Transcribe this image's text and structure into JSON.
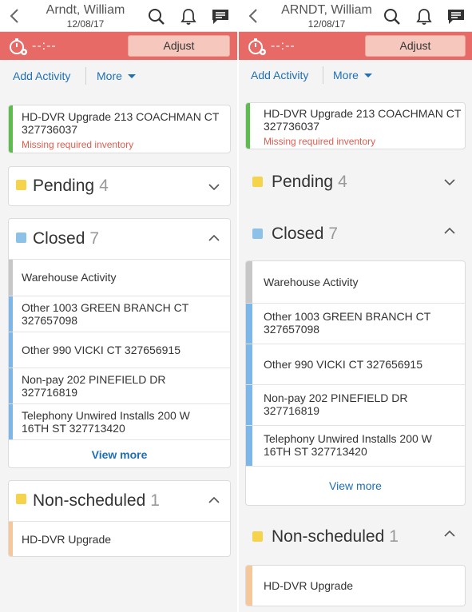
{
  "colors": {
    "red_bar": "#e86a66",
    "link_blue": "#1f6fb5",
    "pending_yellow": "#f5d34b",
    "closed_blue": "#8cc2e8",
    "stripe_green": "#5cbd4d",
    "stripe_gray": "#c7c7c7",
    "stripe_blue": "#7db6e8",
    "stripe_peach": "#f6c79a",
    "warning_red": "#e25c4e"
  },
  "left": {
    "header": {
      "name": "Arndt, William",
      "date": "12/08/17"
    },
    "timer": {
      "text": "--:--",
      "adjust_label": "Adjust"
    },
    "actions": {
      "add_activity": "Add Activity",
      "more": "More"
    },
    "top_card": {
      "title": "HD-DVR Upgrade 213 COACHMAN CT 327736037",
      "warning": "Missing required inventory"
    },
    "pending": {
      "label": "Pending",
      "count": "4"
    },
    "closed": {
      "label": "Closed",
      "count": "7",
      "items": [
        {
          "text": "Warehouse Activity"
        },
        {
          "text": "Other 1003 GREEN BRANCH CT 327657098"
        },
        {
          "text": "Other 990 VICKI CT 327656915"
        },
        {
          "text": "Non-pay 202 PINEFIELD DR 327716819"
        },
        {
          "text": "Telephony Unwired Installs 200 W 16TH ST 327713420"
        }
      ],
      "view_more": "View more"
    },
    "nonscheduled": {
      "label": "Non-scheduled",
      "count": "1",
      "items": [
        {
          "text": "HD-DVR Upgrade"
        }
      ]
    }
  },
  "right": {
    "header": {
      "name": "ARNDT, William",
      "date": "12/08/17"
    },
    "timer": {
      "text": "--:--",
      "adjust_label": "Adjust"
    },
    "actions": {
      "add_activity": "Add Activity",
      "more": "More"
    },
    "top_card": {
      "title": "HD-DVR Upgrade 213 COACHMAN CT 327736037",
      "warning": "Missing required inventory"
    },
    "pending": {
      "label": "Pending",
      "count": "4"
    },
    "closed": {
      "label": "Closed",
      "count": "7",
      "items": [
        {
          "text": "Warehouse Activity"
        },
        {
          "text": "Other 1003 GREEN BRANCH CT 327657098"
        },
        {
          "text": "Other 990 VICKI CT 327656915"
        },
        {
          "text": "Non-pay 202 PINEFIELD DR 327716819"
        },
        {
          "text": "Telephony Unwired Installs 200 W 16TH ST 327713420"
        }
      ],
      "view_more": "View more"
    },
    "nonscheduled": {
      "label": "Non-scheduled",
      "count": "1",
      "items": [
        {
          "text": "HD-DVR Upgrade"
        }
      ]
    }
  },
  "icons": {
    "back": "chevron-left-icon",
    "search": "search-icon",
    "bell": "bell-icon",
    "chat": "chat-icon",
    "timer": "stopwatch-icon",
    "expand": "chevron-down-icon",
    "collapse": "chevron-up-icon"
  }
}
